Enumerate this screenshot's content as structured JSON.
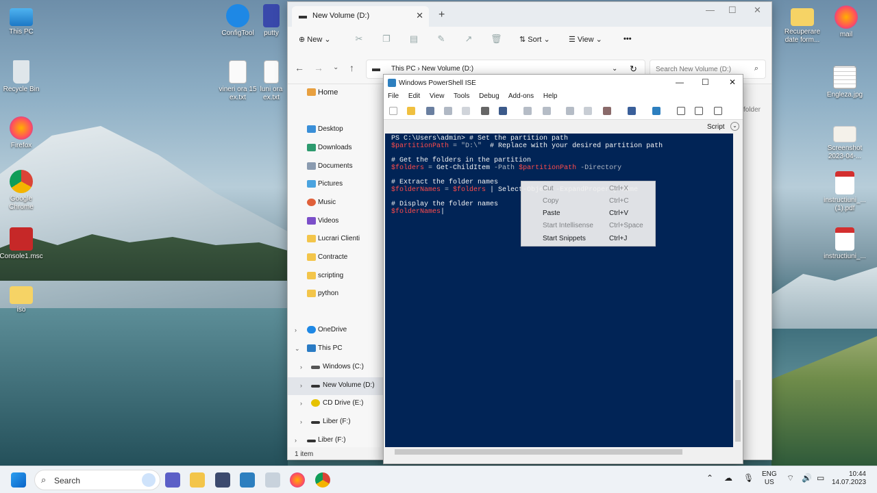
{
  "desktop": {
    "icons_left": [
      "This PC",
      "Recycle Bin",
      "Firefox",
      "Google Chrome",
      "Console1.msc",
      "iso"
    ],
    "icons_top": [
      "ConfigTool",
      "putty",
      "vineri ora 15 ex.txt",
      "luni ora ex.txt"
    ],
    "icons_right": [
      "Recuperare date form...",
      "mail",
      "Engleza.jpg",
      "Screenshot 2023-04-...",
      "instructiuni_... (1).pdf",
      "instructiuni_..."
    ]
  },
  "explorer": {
    "tab_title": "New Volume (D:)",
    "toolbar": {
      "new": "New",
      "sort": "Sort",
      "view": "View",
      "more": "•••"
    },
    "breadcrumb": [
      "This PC",
      "New Volume (D:)"
    ],
    "search_placeholder": "Search New Volume (D:)",
    "sidebar": {
      "home": "Home",
      "quick": [
        "Desktop",
        "Downloads",
        "Documents",
        "Pictures",
        "Music",
        "Videos",
        "Lucrari Clienti",
        "Contracte",
        "scripting",
        "python"
      ],
      "onedrive": "OneDrive",
      "thispc": "This PC",
      "drives": [
        "Windows (C:)",
        "New Volume (D:)",
        "CD Drive (E:)",
        "Liber (F:)",
        "Liber (F:)"
      ]
    },
    "status": "1 item",
    "behind_text": "folder"
  },
  "ise": {
    "title": "Windows PowerShell ISE",
    "menu": [
      "File",
      "Edit",
      "View",
      "Tools",
      "Debug",
      "Add-ons",
      "Help"
    ],
    "script_label": "Script",
    "console": {
      "line1_prompt": "PS C:\\Users\\admin> ",
      "line1_comment": "# Set the partition path",
      "line2_var": "$partitionPath",
      "line2_eq": " = ",
      "line2_str": "\"D:\\\"",
      "line2_comment": "  # Replace with your desired partition path",
      "line3_comment": "# Get the folders in the partition",
      "line4_var": "$folders",
      "line4_eq": " = ",
      "line4_cmd": "Get-ChildItem",
      "line4_p1": " -Path ",
      "line4_var2": "$partitionPath",
      "line4_p2": " -Directory",
      "line5_comment": "# Extract the folder names",
      "line6_var": "$folderNames",
      "line6_eq": " = ",
      "line6_var2": "$folders",
      "line6_rest": " | Select-Object -ExpandProperty Name",
      "line7_comment": "# Display the folder names",
      "line8_var": "$folderNames"
    }
  },
  "context_menu": [
    {
      "label": "Cut",
      "shortcut": "Ctrl+X",
      "enabled": false
    },
    {
      "label": "Copy",
      "shortcut": "Ctrl+C",
      "enabled": false
    },
    {
      "label": "Paste",
      "shortcut": "Ctrl+V",
      "enabled": true
    },
    {
      "label": "Start Intellisense",
      "shortcut": "Ctrl+Space",
      "enabled": false
    },
    {
      "label": "Start Snippets",
      "shortcut": "Ctrl+J",
      "enabled": true
    }
  ],
  "taskbar": {
    "search": "Search",
    "lang": "ENG",
    "region": "US",
    "time": "10:44",
    "date": "14.07.2023"
  },
  "colors": {
    "console_bg": "#012456",
    "accent": "#0067c0"
  }
}
